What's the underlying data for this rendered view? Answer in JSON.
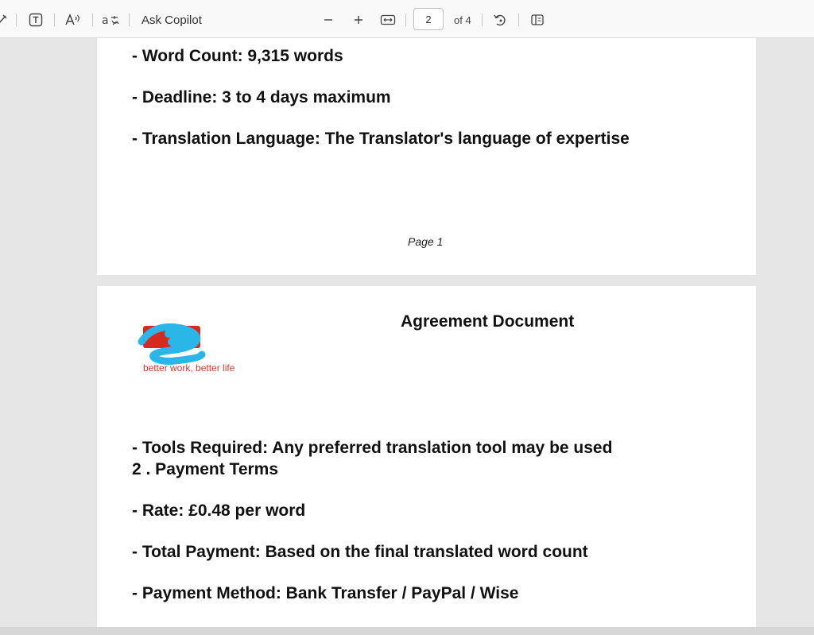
{
  "toolbar": {
    "copilot_label": "Ask Copilot",
    "current_page": "2",
    "page_count_label": "of 4",
    "icons": [
      "draw-icon",
      "text-box-icon",
      "read-aloud-icon",
      "translate-icon",
      "zoom-out-icon",
      "zoom-in-icon",
      "fit-width-icon",
      "rotate-icon",
      "page-view-icon"
    ]
  },
  "page1": {
    "lines": [
      "- Word Count: 9,315 words",
      "- Deadline: 3 to 4 days maximum",
      "- Translation Language: The Translator's language of expertise"
    ],
    "footer": "Page  1"
  },
  "page2": {
    "title": "Agreement Document",
    "logo_tagline": "better work, better life",
    "lines": [
      "- Tools Required: Any preferred translation tool may be used",
      "2 . Payment Terms",
      "- Rate: £0.48 per word",
      "- Total Payment: Based on the final translated word count",
      "- Payment Method: Bank Transfer / PayPal / Wise"
    ]
  },
  "colors": {
    "logo_red": "#d52b1e",
    "scribble_blue": "#2ab6e6"
  }
}
